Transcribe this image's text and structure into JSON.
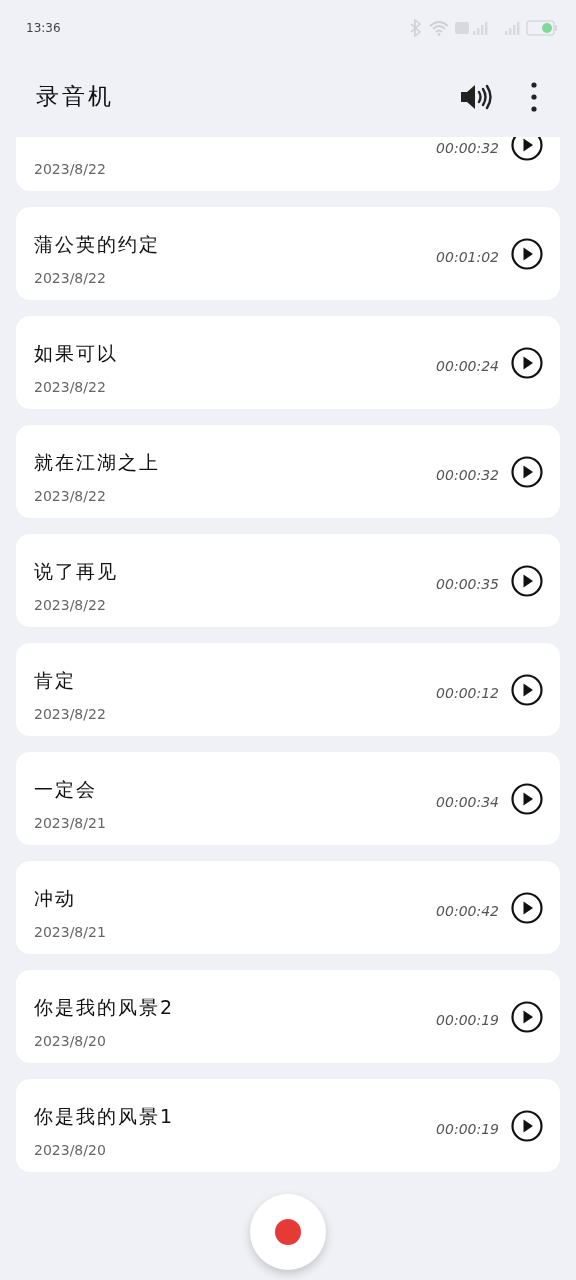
{
  "status_bar": {
    "time": "13:36"
  },
  "app_bar": {
    "title": "录音机"
  },
  "recordings": [
    {
      "date": "2023/8/22",
      "duration": "00:00:32"
    },
    {
      "title": "蒲公英的约定",
      "date": "2023/8/22",
      "duration": "00:01:02"
    },
    {
      "title": "如果可以",
      "date": "2023/8/22",
      "duration": "00:00:24"
    },
    {
      "title": "就在江湖之上",
      "date": "2023/8/22",
      "duration": "00:00:32"
    },
    {
      "title": "说了再见",
      "date": "2023/8/22",
      "duration": "00:00:35"
    },
    {
      "title": "肯定",
      "date": "2023/8/22",
      "duration": "00:00:12"
    },
    {
      "title": "一定会",
      "date": "2023/8/21",
      "duration": "00:00:34"
    },
    {
      "title": "冲动",
      "date": "2023/8/21",
      "duration": "00:00:42"
    },
    {
      "title": "你是我的风景2",
      "date": "2023/8/20",
      "duration": "00:00:19"
    },
    {
      "title": "你是我的风景1",
      "date": "2023/8/20",
      "duration": "00:00:19"
    }
  ]
}
